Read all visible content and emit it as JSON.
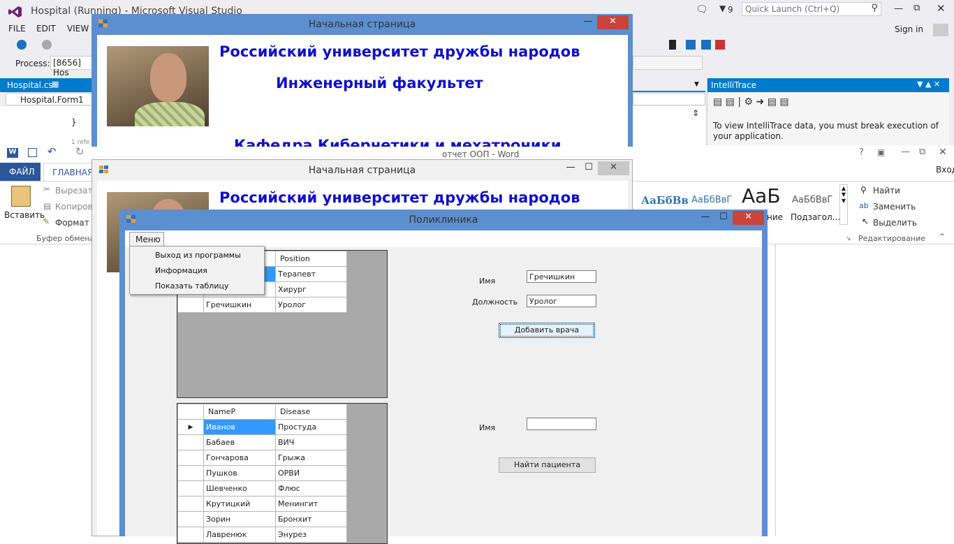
{
  "vs": {
    "title": "Hospital (Running) - Microsoft Visual Studio",
    "notif_count": "9",
    "quick_launch_placeholder": "Quick Launch (Ctrl+Q)",
    "menu": [
      "FILE",
      "EDIT",
      "VIEW"
    ],
    "sign_in": "Sign in",
    "process_label": "Process:",
    "process_value": "[8656] Hos",
    "tab_file": "Hospital.cs",
    "class_combo": "Hospital.Form1",
    "code_brace": "}",
    "code_ref": "1 refe",
    "intellitrace": {
      "title": "IntelliTrace",
      "message": "To view IntelliTrace data, you must break execution of your application."
    }
  },
  "word": {
    "title": "отчет ООП - Word",
    "tab_file": "ФАЙЛ",
    "tab_home": "ГЛАВНАЯ",
    "sign_in": "Вход",
    "paste_label": "Вставить",
    "cut_label": "Вырезать",
    "copy_label": "Копирова",
    "format_label": "Формат п",
    "clipboard_group": "Буфер обмена",
    "styles": [
      "АаБбВв",
      "АаБбВвГ",
      "АаБ",
      "АаБбВвГ"
    ],
    "style_names": [
      "ние",
      "Подзагол..."
    ],
    "find": "Найти",
    "replace": "Заменить",
    "select": "Выделить",
    "editing_group": "Редактирование"
  },
  "start_page": {
    "title": "Начальная страница",
    "line1": "Российский университет дружбы народов",
    "line2": "Инженерный факультет",
    "line3": "Кафедра Кибернетики и мехатроники"
  },
  "clinic": {
    "title": "Поликлиника",
    "menu_label": "Меню",
    "menu_items": [
      "Выход из программы",
      "Информация",
      "Показать таблицу"
    ],
    "doctors": {
      "col_position": "Position",
      "rows": [
        {
          "name": "",
          "position": "Терапевт"
        },
        {
          "name": "",
          "position": "Хирург"
        },
        {
          "name": "Гречишкин",
          "position": "Уролог"
        }
      ]
    },
    "patients": {
      "col_name": "NameP",
      "col_disease": "Disease",
      "rows": [
        {
          "name": "Иванов",
          "disease": "Простуда"
        },
        {
          "name": "Бабаев",
          "disease": "ВИЧ"
        },
        {
          "name": "Гончарова",
          "disease": "Грыжа"
        },
        {
          "name": "Пушков",
          "disease": "ОРВИ"
        },
        {
          "name": "Шевченко",
          "disease": "Флюс"
        },
        {
          "name": "Крутицкий",
          "disease": "Менингит"
        },
        {
          "name": "Зорин",
          "disease": "Бронхит"
        },
        {
          "name": "Лавренюк",
          "disease": "Энурез"
        }
      ]
    },
    "form": {
      "name_label": "Имя",
      "name_value": "Гречишкин",
      "position_label": "Должность",
      "position_value": "Уролог",
      "add_button": "Добавить врача",
      "patient_name_label": "Имя",
      "patient_name_value": "",
      "find_button": "Найти пациента"
    }
  }
}
